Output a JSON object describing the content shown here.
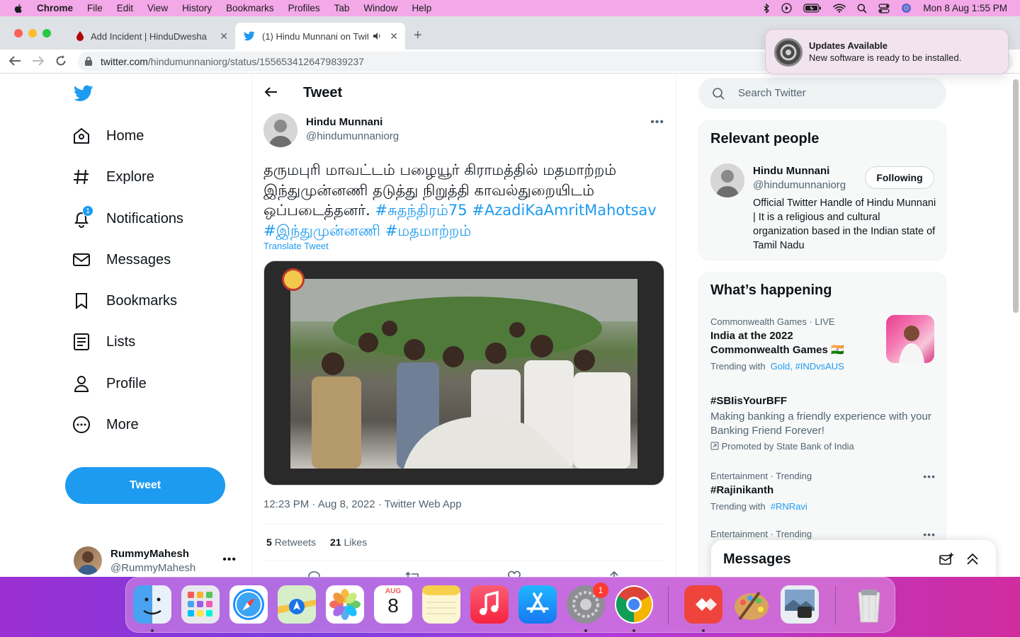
{
  "menubar": {
    "app": "Chrome",
    "items": [
      "File",
      "Edit",
      "View",
      "History",
      "Bookmarks",
      "Profiles",
      "Tab",
      "Window",
      "Help"
    ],
    "datetime": "Mon 8 Aug  1:55 PM"
  },
  "browser": {
    "tabs": [
      {
        "label": "Add Incident | HinduDwesha",
        "icon": "blood-drop-icon",
        "active": false
      },
      {
        "label": "(1) Hindu Munnani on Twitt",
        "icon": "twitter-bird-icon",
        "active": true
      }
    ],
    "url_host": "twitter.com",
    "url_path": "/hindumunnaniorg/status/1556534126479839237"
  },
  "notification": {
    "title": "Updates Available",
    "body": "New software is ready to be installed.",
    "icon": "system-preferences-gear-icon"
  },
  "nav": {
    "items": [
      {
        "label": "Home",
        "icon": "home-icon"
      },
      {
        "label": "Explore",
        "icon": "hashtag-icon"
      },
      {
        "label": "Notifications",
        "icon": "bell-icon",
        "badge": "1"
      },
      {
        "label": "Messages",
        "icon": "envelope-icon"
      },
      {
        "label": "Bookmarks",
        "icon": "bookmark-icon"
      },
      {
        "label": "Lists",
        "icon": "list-icon"
      },
      {
        "label": "Profile",
        "icon": "person-icon"
      },
      {
        "label": "More",
        "icon": "more-circle-icon"
      }
    ],
    "tweet_button": "Tweet",
    "account": {
      "name": "RummyMahesh",
      "handle": "@RummyMahesh"
    }
  },
  "tweet": {
    "header": "Tweet",
    "author_name": "Hindu Munnani",
    "author_handle": "@hindumunnaniorg",
    "text_line1": "தருமபுரி மாவட்டம் பழையூர் கிராமத்தில் மதமாற்றம்",
    "text_line2": "இந்துமுன்னணி தடுத்து நிறுத்தி காவல்துறையிடம்",
    "text_line3": "ஒப்படைத்தனர். ",
    "hashtag1": "#சுதந்திரம்75",
    "hashtag2": "#AzadiKaAmritMahotsav",
    "hashtag3": "#இந்துமுன்னணி",
    "hashtag4": "#மதமாற்றம்",
    "translate": "Translate Tweet",
    "meta": "12:23 PM · Aug 8, 2022 · Twitter Web App",
    "retweets_count": "5",
    "retweets_label": "Retweets",
    "likes_count": "21",
    "likes_label": "Likes"
  },
  "sidebar": {
    "search_placeholder": "Search Twitter",
    "relevant": {
      "title": "Relevant people",
      "name": "Hindu Munnani",
      "handle": "@hindumunnaniorg",
      "follow_label": "Following",
      "bio": "Official Twitter Handle of Hindu Munnani | It is a religious and cultural organization based in the Indian state of Tamil Nadu"
    },
    "happening": {
      "title": "What’s happening",
      "trends": [
        {
          "context": "Commonwealth Games · LIVE",
          "title": "India at the 2022 Commonwealth Games 🇮🇳",
          "sub_prefix": "Trending with",
          "links": "Gold, #INDvsAUS"
        },
        {
          "context": "",
          "title": "#SBIisYourBFF",
          "desc": "Making banking a friendly experience with your Banking Friend Forever!",
          "promoted": "Promoted by State Bank of India"
        },
        {
          "context": "Entertainment · Trending",
          "title": "#Rajinikanth",
          "sub_prefix": "Trending with",
          "links": "#RNRavi"
        },
        {
          "context": "Entertainment · Trending",
          "title": ""
        }
      ]
    }
  },
  "messages_drawer": {
    "title": "Messages"
  },
  "dock": {
    "apps": [
      "Finder",
      "Launchpad",
      "Safari",
      "Maps",
      "Photos",
      "Calendar",
      "Notes",
      "Music",
      "App Store",
      "System Preferences",
      "Chrome",
      "AnyDesk",
      "Paintbrush",
      "Preview",
      "Trash"
    ],
    "calendar_month": "AUG",
    "calendar_day": "8",
    "sysprefs_badge": "1"
  },
  "colors": {
    "twitter_blue": "#1d9bf0",
    "text": "#0f1419",
    "muted": "#536471"
  }
}
